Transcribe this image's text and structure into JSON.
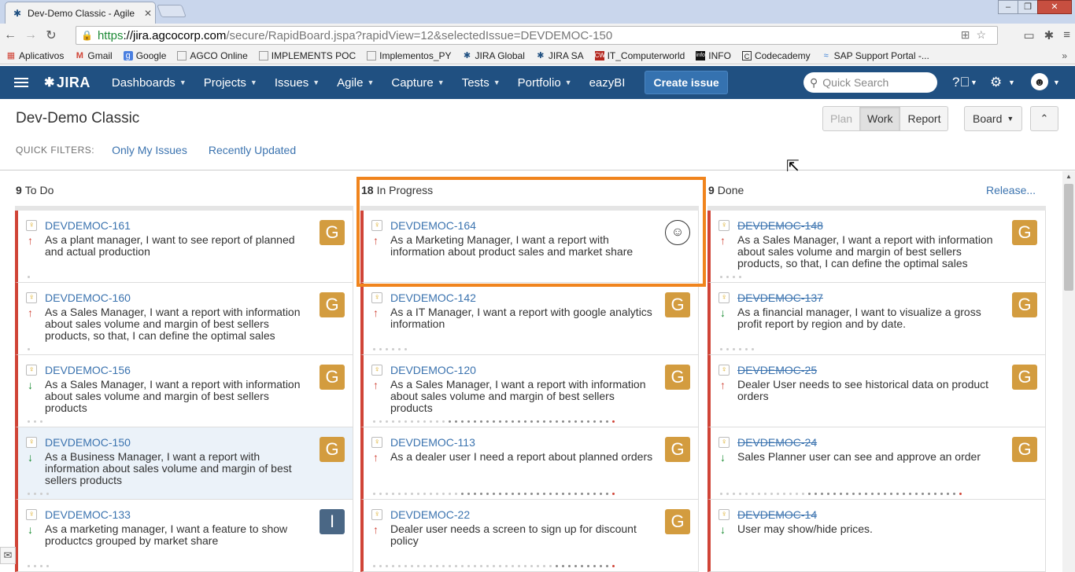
{
  "browser": {
    "tab_title": "Dev-Demo Classic - Agile",
    "url_https": "https",
    "url_host": "://jira.agcocorp.com",
    "url_path": "/secure/RapidBoard.jspa?rapidView=12&selectedIssue=DEVDEMOC-150",
    "bookmarks": [
      "Aplicativos",
      "Gmail",
      "Google",
      "AGCO Online",
      "IMPLEMENTS POC",
      "Implementos_PY",
      "JIRA Global",
      "JIRA SA",
      "IT_Computerworld",
      "INFO",
      "Codecademy",
      "SAP Support Portal -..."
    ],
    "bookmarks_more": "»"
  },
  "header": {
    "logo": "JIRA",
    "nav": [
      "Dashboards",
      "Projects",
      "Issues",
      "Agile",
      "Capture",
      "Tests",
      "Portfolio",
      "eazyBI"
    ],
    "create_label": "Create issue",
    "search_placeholder": "Quick Search"
  },
  "board": {
    "title": "Dev-Demo Classic",
    "modes": [
      "Plan",
      "Work",
      "Report"
    ],
    "board_label": "Board",
    "quick_filters_label": "QUICK FILTERS:",
    "quick_filters": [
      "Only My Issues",
      "Recently Updated"
    ],
    "release_label": "Release..."
  },
  "columns": [
    {
      "count": "9",
      "name": "To Do",
      "cards": [
        {
          "key": "DEVDEMOC-161",
          "summary": "As a plant manager, I want to see report of planned and actual production",
          "prio": "up",
          "avatar": "G"
        },
        {
          "key": "DEVDEMOC-160",
          "summary": "As a Sales Manager, I want a report with information about sales volume and margin of best sellers products, so that, I can define the optimal sales",
          "prio": "up",
          "avatar": "G"
        },
        {
          "key": "DEVDEMOC-156",
          "summary": "As a Sales Manager, I want a report with information about sales volume and margin of best sellers products",
          "prio": "down",
          "avatar": "G"
        },
        {
          "key": "DEVDEMOC-150",
          "summary": "As a Business Manager, I want a report with information about sales volume and margin of best sellers products",
          "prio": "down",
          "avatar": "G"
        },
        {
          "key": "DEVDEMOC-133",
          "summary": "As a marketing manager, I want a feature to show productcs grouped by market share",
          "prio": "down",
          "avatar": "I"
        }
      ]
    },
    {
      "count": "18",
      "name": "In Progress",
      "cards": [
        {
          "key": "DEVDEMOC-164",
          "summary": "As a Marketing Manager, I want a report with information about product sales and market share",
          "prio": "up",
          "avatar": "☺"
        },
        {
          "key": "DEVDEMOC-142",
          "summary": "As a IT Manager, I want a report with google analytics information",
          "prio": "up",
          "avatar": "G"
        },
        {
          "key": "DEVDEMOC-120",
          "summary": "As a Sales Manager, I want a report with information about sales volume and margin of best sellers products",
          "prio": "up",
          "avatar": "G"
        },
        {
          "key": "DEVDEMOC-113",
          "summary": "As a dealer user I need a report about planned orders",
          "prio": "up",
          "avatar": "G"
        },
        {
          "key": "DEVDEMOC-22",
          "summary": "Dealer user needs a screen to sign up for discount policy",
          "prio": "up",
          "avatar": "G"
        }
      ]
    },
    {
      "count": "9",
      "name": "Done",
      "cards": [
        {
          "key": "DEVDEMOC-148",
          "summary": "As a Sales Manager, I want a report with information about sales volume and margin of best sellers products, so that, I can define the optimal sales",
          "prio": "up",
          "avatar": "G"
        },
        {
          "key": "DEVDEMOC-137",
          "summary": "As a financial manager, I want to visualize a gross profit report by region and by date.",
          "prio": "down",
          "avatar": "G"
        },
        {
          "key": "DEVDEMOC-25",
          "summary": "Dealer User needs to see historical data on product orders",
          "prio": "up",
          "avatar": "G"
        },
        {
          "key": "DEVDEMOC-24",
          "summary": "Sales Planner user can see and approve an order",
          "prio": "down",
          "avatar": "G"
        },
        {
          "key": "DEVDEMOC-14",
          "summary": "User may show/hide prices.",
          "prio": "down",
          "avatar": ""
        }
      ]
    }
  ],
  "colors": {
    "header_bg": "#205081",
    "link": "#3b73af",
    "card_border": "#d04437",
    "avatar_bg": "#d39c3f",
    "highlight": "#f0841d"
  }
}
